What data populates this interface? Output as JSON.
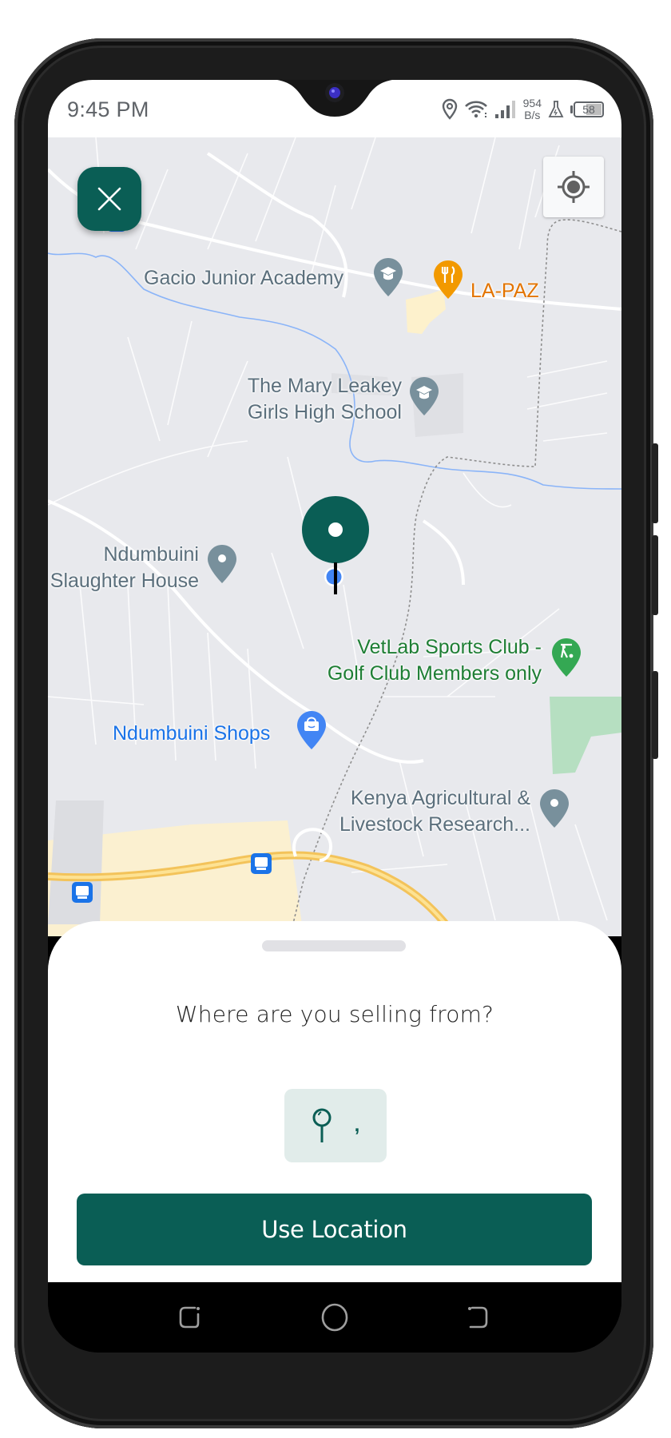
{
  "status_bar": {
    "time": "9:45 PM",
    "net_speed_value": "954",
    "net_speed_unit": "B/s",
    "battery_level": "58",
    "icons": [
      "location-icon",
      "wifi-icon",
      "signal-icon",
      "flask-icon",
      "battery-icon"
    ]
  },
  "map": {
    "labels": {
      "gacio": "Gacio Junior Academy",
      "lapaz": "LA-PAZ",
      "mary_leakey_1": "The Mary Leakey",
      "mary_leakey_2": "Girls High School",
      "slaughter_1": "Ndumbuini",
      "slaughter_2": "Slaughter House",
      "vetlab_1": "VetLab Sports Club -",
      "vetlab_2": "Golf Club Members only",
      "shops": "Ndumbuini Shops",
      "kenya_1": "Kenya Agricultural &",
      "kenya_2": "Livestock Research..."
    },
    "controls": {
      "close": "close-icon",
      "my_location": "my-location-icon"
    }
  },
  "sheet": {
    "title": "Where are you selling from?",
    "location_value": ",",
    "primary_button": "Use Location"
  },
  "colors": {
    "brand": "#0a5e55",
    "chip_bg": "#e1ecea",
    "map_bg": "#e8e9ed"
  },
  "nav_bar": {
    "items": [
      "recents",
      "home",
      "back"
    ]
  }
}
